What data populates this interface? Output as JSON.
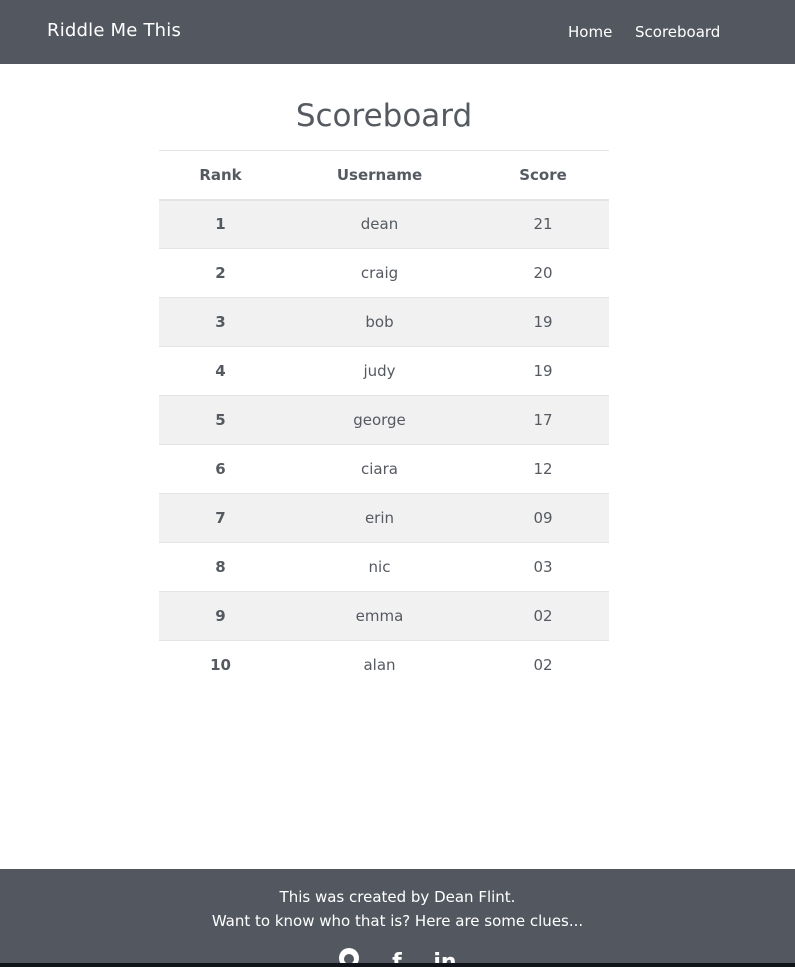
{
  "navbar": {
    "brand": "Riddle Me This",
    "links": [
      {
        "label": "Home"
      },
      {
        "label": "Scoreboard"
      }
    ]
  },
  "main": {
    "title": "Scoreboard",
    "table": {
      "headers": [
        "Rank",
        "Username",
        "Score"
      ],
      "rows": [
        {
          "rank": "1",
          "username": "dean",
          "score": "21"
        },
        {
          "rank": "2",
          "username": "craig",
          "score": "20"
        },
        {
          "rank": "3",
          "username": "bob",
          "score": "19"
        },
        {
          "rank": "4",
          "username": "judy",
          "score": "19"
        },
        {
          "rank": "5",
          "username": "george",
          "score": "17"
        },
        {
          "rank": "6",
          "username": "ciara",
          "score": "12"
        },
        {
          "rank": "7",
          "username": "erin",
          "score": "09"
        },
        {
          "rank": "8",
          "username": "nic",
          "score": "03"
        },
        {
          "rank": "9",
          "username": "emma",
          "score": "02"
        },
        {
          "rank": "10",
          "username": "alan",
          "score": "02"
        }
      ]
    }
  },
  "footer": {
    "line1": "This was created by Dean Flint.",
    "line2": "Want to know who that is? Here are some clues...",
    "social_icons": [
      "github-icon",
      "facebook-icon",
      "linkedin-icon"
    ]
  },
  "colors": {
    "navbar_bg": "#535860",
    "footer_bg": "#535860",
    "striped_row": "#f1f1f1",
    "text": "#555a61"
  }
}
